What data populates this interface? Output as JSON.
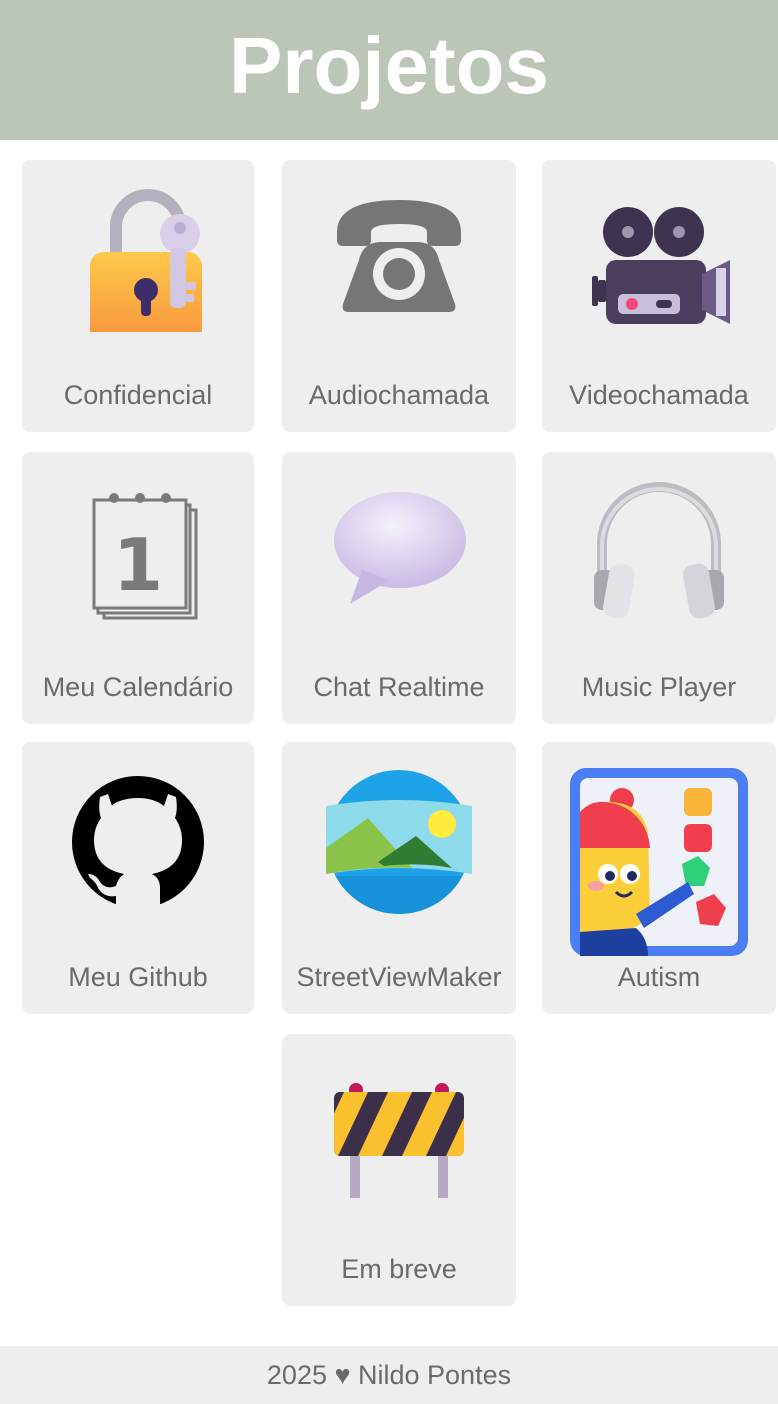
{
  "header": {
    "title": "Projetos"
  },
  "projects": [
    {
      "label": "Confidencial",
      "icon": "lock-with-key-icon"
    },
    {
      "label": "Audiochamada",
      "icon": "telephone-icon"
    },
    {
      "label": "Videochamada",
      "icon": "movie-camera-icon"
    },
    {
      "label": "Meu Calendário",
      "icon": "calendar-icon"
    },
    {
      "label": "Chat Realtime",
      "icon": "speech-bubble-icon"
    },
    {
      "label": "Music Player",
      "icon": "headphones-icon"
    },
    {
      "label": "Meu Github",
      "icon": "github-icon"
    },
    {
      "label": "StreetViewMaker",
      "icon": "panorama-icon"
    },
    {
      "label": "Autism",
      "icon": "autism-game-icon"
    },
    {
      "label": "Em breve",
      "icon": "construction-barrier-icon"
    }
  ],
  "footer": {
    "text": "2025 ♥ Nildo Pontes"
  },
  "colors": {
    "header_bg": "#bcc6b8",
    "card_bg": "#eeeeee",
    "label_text": "#6a6a6a"
  }
}
